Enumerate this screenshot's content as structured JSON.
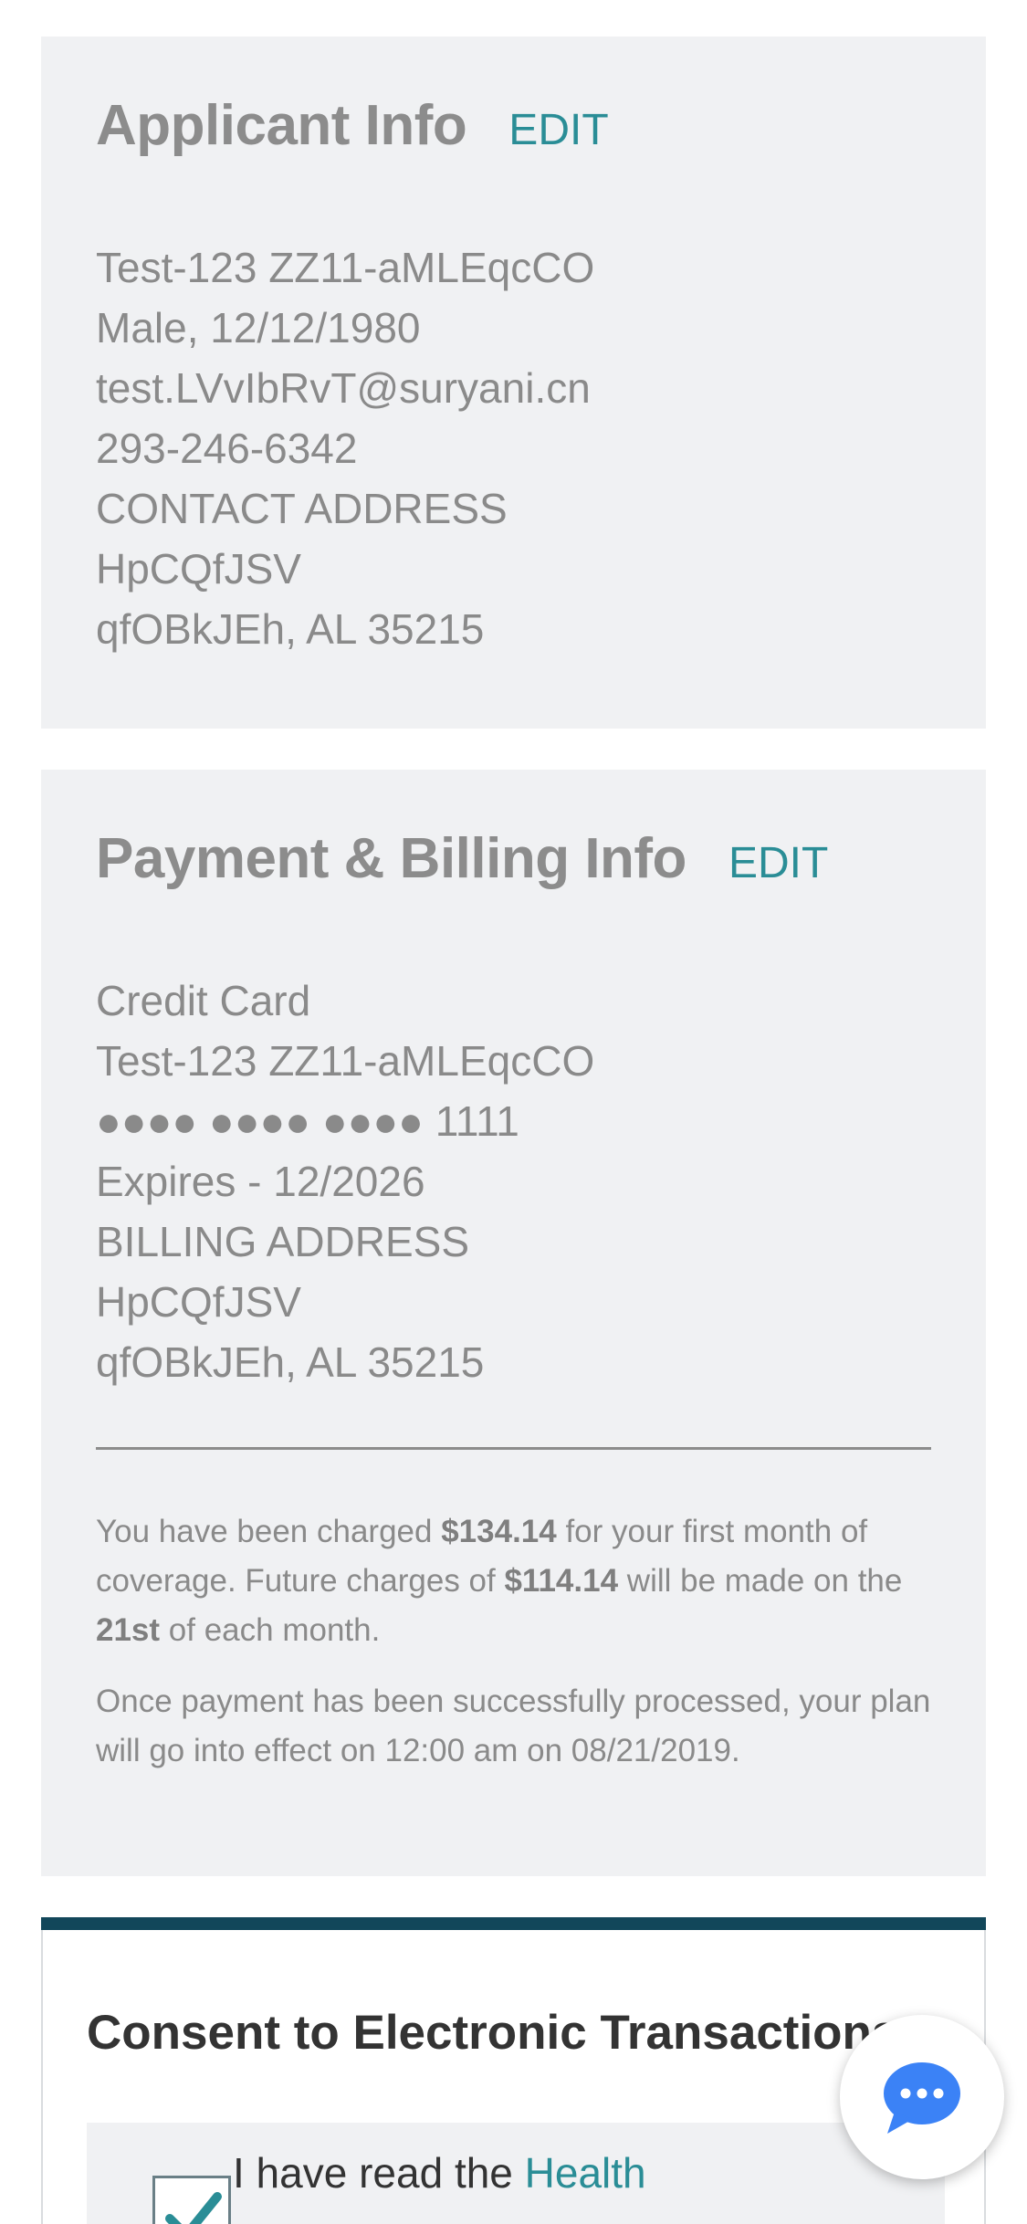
{
  "applicant": {
    "title": "Applicant Info",
    "edit_label": "EDIT",
    "lines": [
      "Test-123 ZZ11-aMLEqcCO",
      "Male, 12/12/1980",
      "test.LVvIbRvT@suryani.cn",
      "293-246-6342",
      "CONTACT ADDRESS",
      "HpCQfJSV",
      "qfOBkJEh, AL 35215"
    ]
  },
  "payment": {
    "title": "Payment & Billing Info",
    "edit_label": "EDIT",
    "lines": [
      "Credit Card",
      "Test-123 ZZ11-aMLEqcCO",
      "●●●● ●●●● ●●●● 1111",
      "Expires - 12/2026",
      "BILLING ADDRESS",
      "HpCQfJSV",
      "qfOBkJEh, AL 35215"
    ],
    "charge_notice": {
      "part1": "You have been charged ",
      "first_amount": "$134.14",
      "part2": " for your first month of coverage. Future charges of ",
      "future_amount": "$114.14",
      "part3": " will be made on the ",
      "charge_day": "21st",
      "part4": " of each month."
    },
    "effective_notice": "Once payment has been successfully processed, your plan will go into effect on 12:00 am on 08/21/2019."
  },
  "consent": {
    "title": "Consent to Electronic Transactions",
    "checkbox_checked": true,
    "text_prefix": "I have read the ",
    "link_text": "Health",
    "accent_color": "#12475a"
  },
  "chat": {
    "icon": "chat-bubble-icon",
    "color": "#3b82f6"
  }
}
